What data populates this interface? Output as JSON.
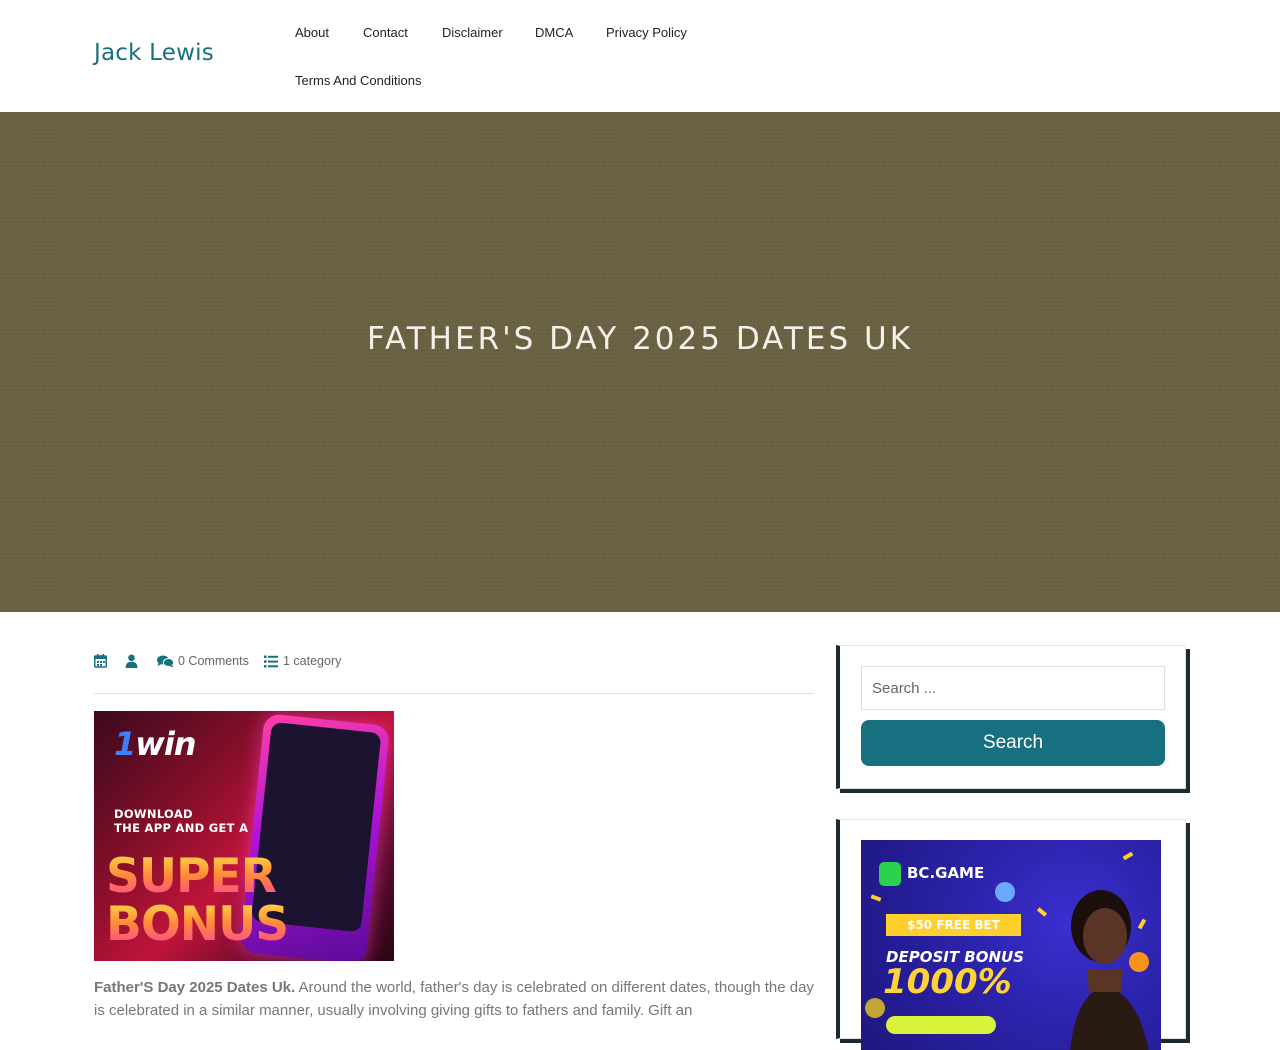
{
  "site": {
    "title": "Jack Lewis"
  },
  "nav": {
    "items": [
      {
        "label": "About"
      },
      {
        "label": "Contact"
      },
      {
        "label": "Disclaimer"
      },
      {
        "label": "DMCA"
      },
      {
        "label": "Privacy Policy"
      },
      {
        "label": "Terms And Conditions"
      }
    ]
  },
  "hero": {
    "title": "FATHER'S DAY 2025 DATES UK"
  },
  "meta": {
    "comments": "0 Comments",
    "category": "1 category"
  },
  "ad_1win": {
    "brand_one": "1",
    "brand_rest": "win",
    "line1": "DOWNLOAD",
    "line2": "THE APP AND GET A",
    "super": "SUPER",
    "bonus": "BONUS"
  },
  "article": {
    "lead": "Father'S Day 2025 Dates Uk.",
    "body": " Around the world, father's day is celebrated on different dates, though the day is celebrated in a similar manner, usually involving giving gifts to fathers and family. Gift an"
  },
  "sidebar": {
    "search": {
      "placeholder": "Search ...",
      "button_label": "Search"
    },
    "ad_bcgame": {
      "brand": "BC.GAME",
      "free_bet": "$50 FREE BET",
      "deposit": "DEPOSIT BONUS",
      "percent": "1000%"
    }
  },
  "colors": {
    "accent": "#17707f",
    "hero_bg": "#6b6243",
    "widget_border": "#1b2a2f"
  }
}
